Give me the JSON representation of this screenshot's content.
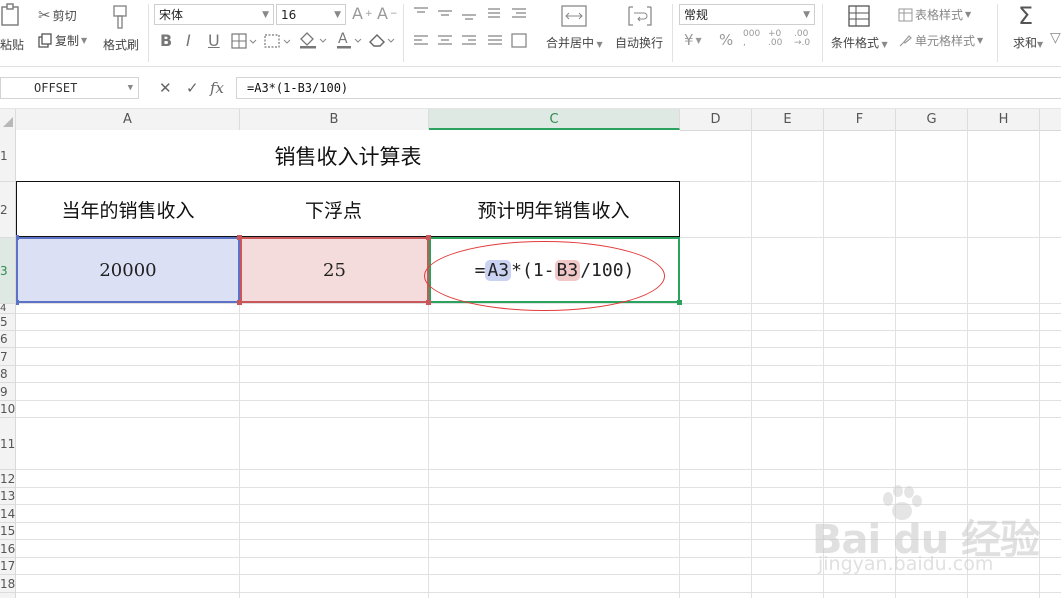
{
  "ribbon": {
    "paste": "粘贴",
    "cut": "剪切",
    "copy": "复制",
    "format_painter": "格式刷",
    "font_name": "宋体",
    "font_size": "16",
    "number_format": "常规",
    "merge_center": "合并居中",
    "auto_wrap": "自动换行",
    "conditional_format": "条件格式",
    "table_style": "表格样式",
    "cell_style": "单元格样式",
    "sum": "求和"
  },
  "formula_bar": {
    "name_box": "OFFSET",
    "fx": "fx",
    "formula": "=A3*(1-B3/100)"
  },
  "columns": [
    "A",
    "B",
    "C",
    "D",
    "E",
    "F",
    "G",
    "H"
  ],
  "selected_column": "C",
  "rows": [
    "1",
    "2",
    "3",
    "4",
    "5",
    "6",
    "7",
    "8",
    "9",
    "10",
    "11",
    "12",
    "13",
    "14",
    "15",
    "16",
    "17",
    "18"
  ],
  "sheet": {
    "title": "销售收入计算表",
    "headers": [
      "当年的销售收入",
      "下浮点",
      "预计明年销售收入"
    ],
    "a3": "20000",
    "b3": "25",
    "c3_parts": [
      "=",
      "A3",
      "*(1-",
      "B3",
      "/100)"
    ]
  },
  "watermark": {
    "brand": "Bai du 经验",
    "url": "jingyan.baidu.com"
  },
  "colors": {
    "selection_green": "#2ca25f",
    "ref_a_blue": "#5b72c7",
    "ref_b_red": "#c9575a",
    "annotation_oval": "#e23b3b"
  }
}
